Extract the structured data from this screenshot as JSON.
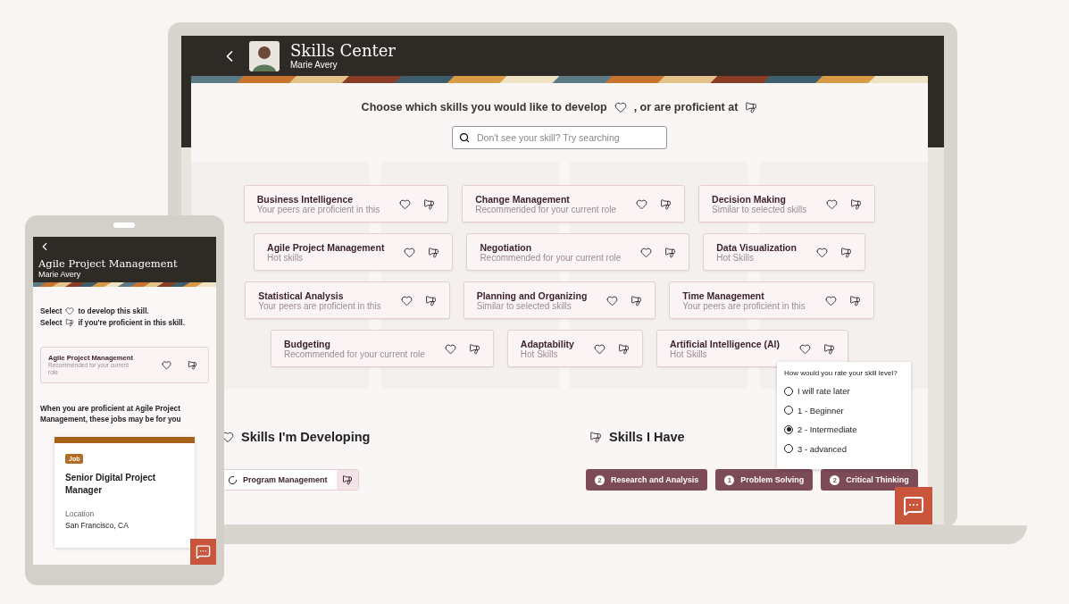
{
  "laptop": {
    "header": {
      "title": "Skills Center",
      "subtitle": "Marie Avery"
    },
    "prompt": [
      {
        "text": "Choose which skills you would like to develop",
        "kind": "develop"
      },
      {
        "text": ", or are proficient at",
        "kind": "proficient"
      }
    ],
    "search": {
      "placeholder": "Don't see your skill? Try searching"
    },
    "skill_rows": [
      [
        {
          "name": "Business Intelligence",
          "note": "Your peers are proficient in this"
        },
        {
          "name": "Change Management",
          "note": "Recommended for your current role"
        },
        {
          "name": "Decision Making",
          "note": "Similar to selected skills"
        }
      ],
      [
        {
          "name": "Agile Project Management",
          "note": "Hot skills"
        },
        {
          "name": "Negotiation",
          "note": "Recommended for your current role"
        },
        {
          "name": "Data Visualization",
          "note": "Hot Skills"
        }
      ],
      [
        {
          "name": "Statistical Analysis",
          "note": "Your peers are proficient in this"
        },
        {
          "name": "Planning and Organizing",
          "note": "Similar to selected skills"
        },
        {
          "name": "Time Management",
          "note": "Your peers are proficient in this"
        }
      ],
      [
        {
          "name": "Budgeting",
          "note": "Recommended for your current role"
        },
        {
          "name": "Adaptability",
          "note": "Hot Skills"
        },
        {
          "name": "Artificial Intelligence (AI)",
          "note": "Hot Skills"
        }
      ]
    ],
    "rating_popup": {
      "question": "How would you rate your skill level?",
      "options": [
        {
          "label": "I will rate later",
          "selected": false
        },
        {
          "label": "1 - Beginner",
          "selected": false
        },
        {
          "label": "2 - Intermediate",
          "selected": true
        },
        {
          "label": "3 - advanced",
          "selected": false
        }
      ]
    },
    "developing": {
      "title": "Skills I'm Developing",
      "items": [
        {
          "label": "Program Management"
        }
      ]
    },
    "have": {
      "title": "Skills I Have",
      "items": [
        {
          "count": "2",
          "label": "Research and Analysis"
        },
        {
          "count": "1",
          "label": "Problem Solving"
        },
        {
          "count": "2",
          "label": "Critical Thinking"
        }
      ]
    }
  },
  "phone": {
    "header": {
      "title": "Agile Project Management",
      "subtitle": "Marie Avery"
    },
    "instructions": [
      {
        "before": "Select",
        "kind": "develop",
        "after": "to develop this skill."
      },
      {
        "before": "Select",
        "kind": "proficient",
        "after": "if you're proficient in this skill."
      }
    ],
    "skill": {
      "name": "Agile Project Management",
      "note": "Recommended for your current role"
    },
    "jobs_intro": "When you are proficient at Agile Project Management, these jobs may be for you",
    "job": {
      "badge": "Job",
      "title": "Senior Digital Project Manager",
      "location_label": "Location",
      "location": "San Francisco, CA"
    }
  }
}
